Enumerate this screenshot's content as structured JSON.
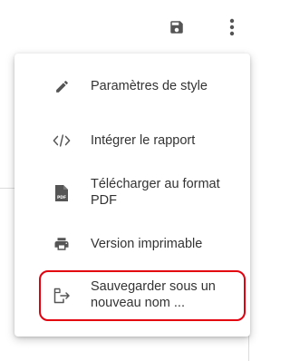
{
  "toolbar": {
    "save_icon": "floppy-disk-icon",
    "more_icon": "vertical-dots-icon"
  },
  "menu": {
    "items": [
      {
        "label": "Paramètres de style",
        "icon": "pencil-icon"
      },
      {
        "label": "Intégrer le rapport",
        "icon": "code-icon"
      },
      {
        "label": "Télécharger au format PDF",
        "icon": "pdf-file-icon"
      },
      {
        "label": "Version imprimable",
        "icon": "printer-icon"
      },
      {
        "label": "Sauvegarder sous un nouveau nom ...",
        "icon": "save-as-icon",
        "highlighted": true
      }
    ]
  },
  "colors": {
    "highlight_border": "#e3000f",
    "icon": "#555555",
    "text": "#333333"
  }
}
